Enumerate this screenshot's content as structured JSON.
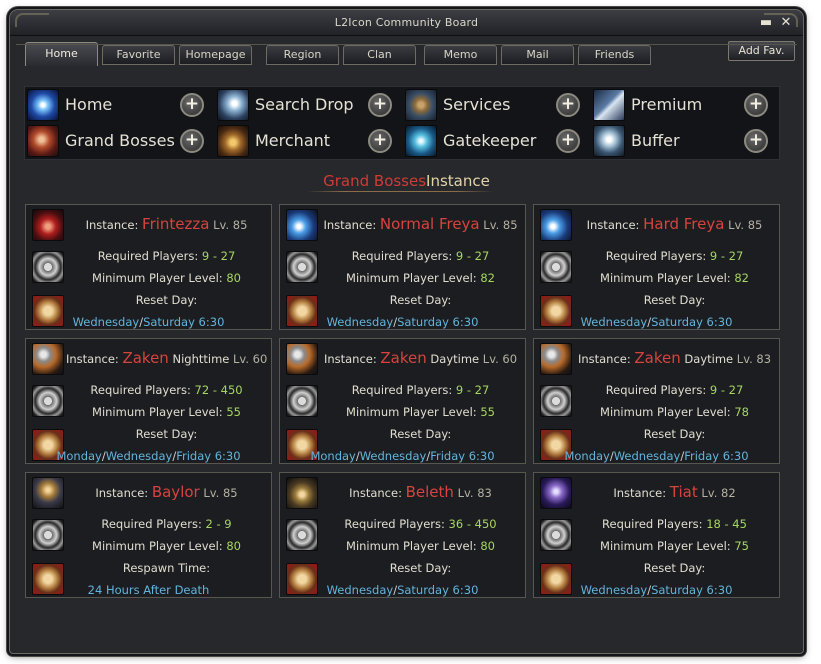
{
  "window": {
    "title": "L2Icon Community Board"
  },
  "tabs": [
    {
      "label": "Home",
      "active": true
    },
    {
      "label": "Favorite",
      "active": false
    },
    {
      "label": "Homepage",
      "active": false
    },
    {
      "label": "Region",
      "active": false
    },
    {
      "label": "Clan",
      "active": false
    },
    {
      "label": "Memo",
      "active": false
    },
    {
      "label": "Mail",
      "active": false
    },
    {
      "label": "Friends",
      "active": false
    }
  ],
  "add_fav_label": "Add Fav.",
  "quick_menu": [
    {
      "label": "Home",
      "icon": "home-icon"
    },
    {
      "label": "Search Drop",
      "icon": "search-drop-icon"
    },
    {
      "label": "Services",
      "icon": "services-icon"
    },
    {
      "label": "Premium",
      "icon": "premium-icon"
    },
    {
      "label": "Grand Bosses",
      "icon": "grand-bosses-icon"
    },
    {
      "label": "Merchant",
      "icon": "merchant-icon"
    },
    {
      "label": "Gatekeeper",
      "icon": "gatekeeper-icon"
    },
    {
      "label": "Buffer",
      "icon": "buffer-icon"
    }
  ],
  "plus_symbol": "+",
  "heading": {
    "part1": "Grand Bosses",
    "part2": "Instance"
  },
  "labels": {
    "instance": "Instance:",
    "required_players": "Required Players:",
    "min_level": "Minimum Player Level:",
    "reset_day": "Reset Day:",
    "respawn_time": "Respawn Time:",
    "slash": "/"
  },
  "instances": [
    {
      "name": "Frintezza",
      "suffix": "",
      "level": "Lv. 85",
      "players": "9 - 27",
      "min_level": "80",
      "reset_label_key": "reset",
      "schedule": [
        "Wednesday",
        "Saturday 6:30"
      ],
      "icon": "frintezza-icon"
    },
    {
      "name": "Normal Freya",
      "suffix": "",
      "level": "Lv. 85",
      "players": "9 - 27",
      "min_level": "82",
      "reset_label_key": "reset",
      "schedule": [
        "Wednesday",
        "Saturday 6:30"
      ],
      "icon": "normal-freya-icon"
    },
    {
      "name": "Hard Freya",
      "suffix": "",
      "level": "Lv. 85",
      "players": "9 - 27",
      "min_level": "82",
      "reset_label_key": "reset",
      "schedule": [
        "Wednesday",
        "Saturday 6:30"
      ],
      "icon": "hard-freya-icon"
    },
    {
      "name": "Zaken",
      "suffix": "Nighttime",
      "level": "Lv. 60",
      "players": "72 - 450",
      "min_level": "55",
      "reset_label_key": "reset",
      "schedule": [
        "Monday",
        "Wednesday",
        "Friday 6:30"
      ],
      "icon": "zaken-icon"
    },
    {
      "name": "Zaken",
      "suffix": "Daytime",
      "level": "Lv. 60",
      "players": "9 - 27",
      "min_level": "55",
      "reset_label_key": "reset",
      "schedule": [
        "Monday",
        "Wednesday",
        "Friday 6:30"
      ],
      "icon": "zaken-icon"
    },
    {
      "name": "Zaken",
      "suffix": "Daytime",
      "level": "Lv. 83",
      "players": "9 - 27",
      "min_level": "78",
      "reset_label_key": "reset",
      "schedule": [
        "Monday",
        "Wednesday",
        "Friday 6:30"
      ],
      "icon": "zaken-icon"
    },
    {
      "name": "Baylor",
      "suffix": "",
      "level": "Lv. 85",
      "players": "2 - 9",
      "min_level": "80",
      "reset_label_key": "respawn",
      "schedule": [
        "24 Hours After Death"
      ],
      "icon": "baylor-icon"
    },
    {
      "name": "Beleth",
      "suffix": "",
      "level": "Lv. 83",
      "players": "36 - 450",
      "min_level": "80",
      "reset_label_key": "reset",
      "schedule": [
        "Wednesday",
        "Saturday 6:30"
      ],
      "icon": "beleth-icon"
    },
    {
      "name": "Tiat",
      "suffix": "",
      "level": "Lv. 82",
      "players": "18 - 45",
      "min_level": "75",
      "reset_label_key": "reset",
      "schedule": [
        "Wednesday",
        "Saturday 6:30"
      ],
      "icon": "tiat-icon"
    }
  ],
  "colors": {
    "boss_name": "#d7433d",
    "value_green": "#a6d660",
    "schedule_blue": "#63b4dc",
    "panel_bg": "#26282c"
  }
}
